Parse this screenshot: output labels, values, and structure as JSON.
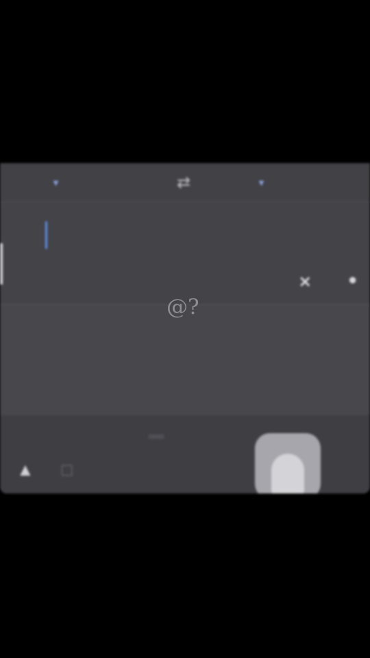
{
  "header": {
    "source_language": "",
    "target_language": "",
    "swap_icon": "swap-icon"
  },
  "input": {
    "value": "",
    "clear_icon": "clear-icon",
    "mic_icon": "microphone-icon"
  },
  "output": {
    "text": "",
    "side_label": ""
  },
  "bottom": {
    "label": "",
    "end_label": ""
  },
  "watermark": "@?",
  "colors": {
    "background": "#000000",
    "panel": "#46464b",
    "accent": "#6f8fd8",
    "caret": "#5e8ee8"
  }
}
